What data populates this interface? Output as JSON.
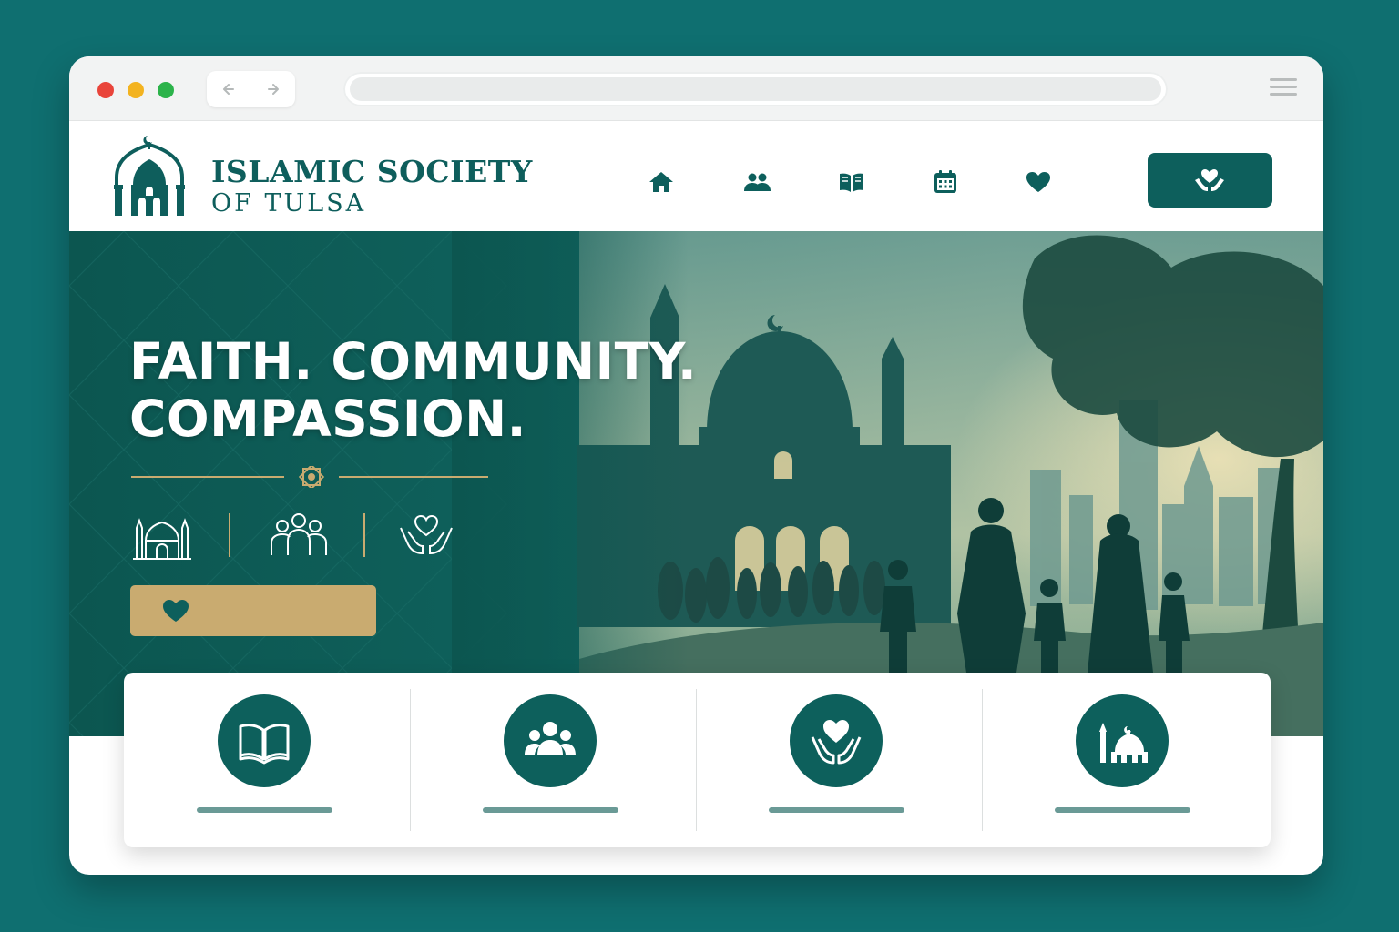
{
  "brand": {
    "name_line1": "ISLAMIC SOCIETY",
    "name_line2": "OF TULSA"
  },
  "colors": {
    "primary": "#0d5f5c",
    "accent_gold": "#c9ab70",
    "page_background": "#0f6f70"
  },
  "nav": {
    "icons": [
      "home-icon",
      "community-icon",
      "book-icon",
      "calendar-icon",
      "heart-icon"
    ]
  },
  "header_button_icon": "helping-hands-heart-icon",
  "hero": {
    "headline_line1": "FAITH. COMMUNITY.",
    "headline_line2": "COMPASSION.",
    "icons": [
      "mosque-icon",
      "people-icon",
      "helping-hands-heart-icon"
    ],
    "cta_icon": "heart-icon"
  },
  "features": [
    {
      "icon": "open-book-icon"
    },
    {
      "icon": "people-group-icon"
    },
    {
      "icon": "helping-hands-heart-icon"
    },
    {
      "icon": "mosque-icon"
    }
  ]
}
